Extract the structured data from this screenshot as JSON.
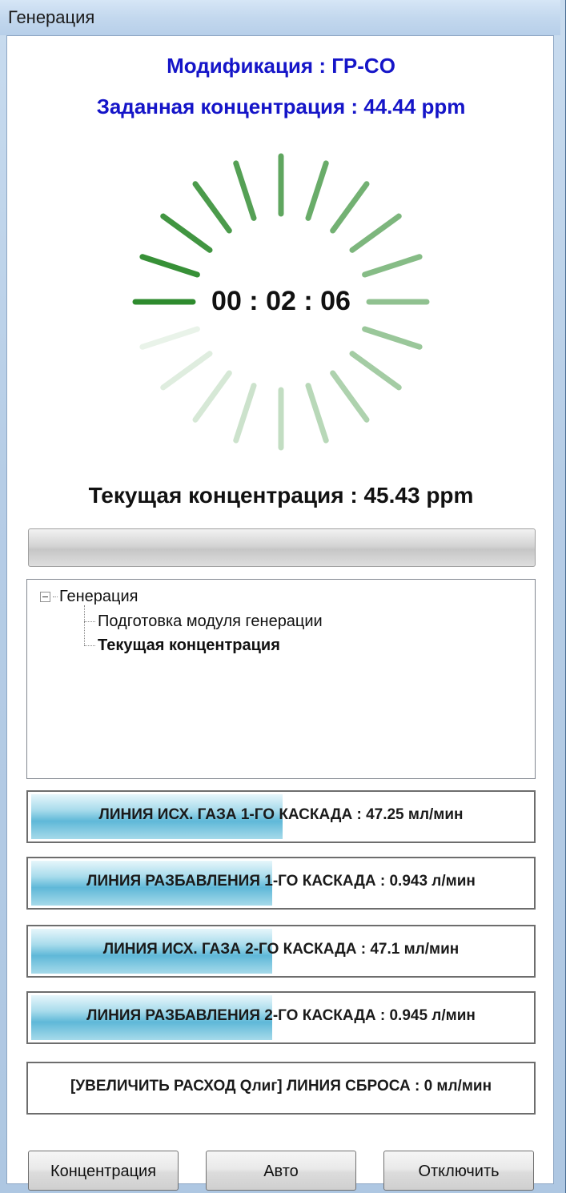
{
  "window": {
    "title": "Генерация"
  },
  "header": {
    "modification": "Модификация : ГР-CO",
    "target_concentration": "Заданная концентрация : 44.44 ppm"
  },
  "timer": "00 : 02 : 06",
  "current_concentration": "Текущая концентрация : 45.43 ppm",
  "tree": {
    "root": "Генерация",
    "children": [
      "Подготовка модуля генерации",
      "Текущая концентрация"
    ]
  },
  "lines": [
    {
      "label": "ЛИНИЯ ИСХ. ГАЗА 1-ГО КАСКАДА : 47.25 мл/мин",
      "fill_fraction": 0.5
    },
    {
      "label": "ЛИНИЯ РАЗБАВЛЕНИЯ 1-ГО КАСКАДА : 0.943 л/мин",
      "fill_fraction": 0.48
    },
    {
      "label": "ЛИНИЯ ИСХ. ГАЗА 2-ГО КАСКАДА : 47.1 мл/мин",
      "fill_fraction": 0.48
    },
    {
      "label": "ЛИНИЯ РАЗБАВЛЕНИЯ 2-ГО КАСКАДА : 0.945 л/мин",
      "fill_fraction": 0.48
    },
    {
      "label": "[УВЕЛИЧИТЬ РАСХОД Qлиг] ЛИНИЯ СБРОСА : 0 мл/мин",
      "fill_fraction": 0
    }
  ],
  "buttons": {
    "concentration": "Концентрация",
    "auto": "Авто",
    "disable": "Отключить"
  },
  "colors": {
    "heading": "#1515c8",
    "spinner": "#2e8b2e",
    "flow_fill": "#5fb8d8"
  }
}
